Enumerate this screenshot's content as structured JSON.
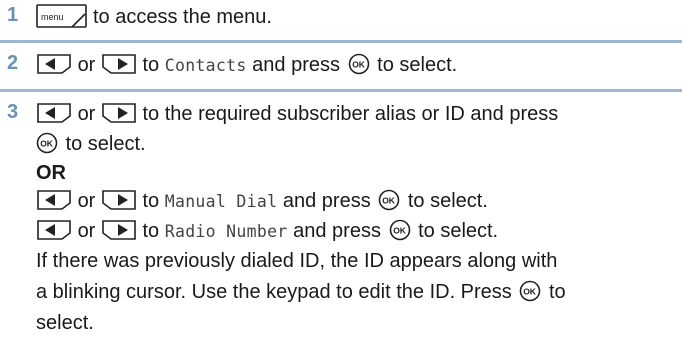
{
  "steps": [
    {
      "number": "1",
      "key_label": "menu",
      "text": "to access the menu."
    },
    {
      "number": "2",
      "or": "or",
      "to": "to",
      "item": "Contacts",
      "and_press": "and press",
      "ok_label": "OK",
      "tail": "to select."
    },
    {
      "number": "3",
      "line1": "to the required subscriber alias or ID and press",
      "line2_tail": "to select.",
      "or_heading": "OR",
      "manual_item": "Manual Dial",
      "radio_item": "Radio Number",
      "para1": "If there was previously dialed ID, the ID appears along with",
      "para2": "a blinking cursor. Use the keypad to edit the ID. Press",
      "para2_tail": "to",
      "para3": "select."
    }
  ],
  "colors": {
    "step_number": "#6a90b8",
    "divider": "#9fb6cf",
    "text": "#1a1a1a"
  }
}
